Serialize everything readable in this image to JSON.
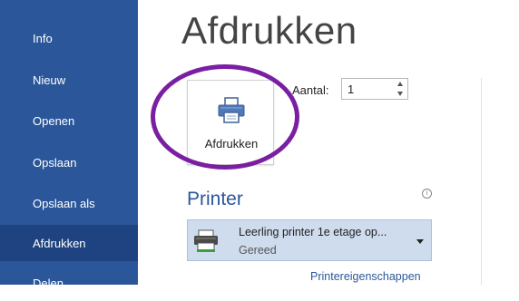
{
  "sidebar": {
    "items": [
      {
        "label": "Info"
      },
      {
        "label": "Nieuw"
      },
      {
        "label": "Openen"
      },
      {
        "label": "Opslaan"
      },
      {
        "label": "Opslaan als"
      },
      {
        "label": "Afdrukken",
        "active": true
      },
      {
        "label": "Delen"
      }
    ]
  },
  "main": {
    "title": "Afdrukken",
    "print_button": {
      "label": "Afdrukken",
      "icon": "printer-icon"
    },
    "copies": {
      "label": "Aantal:",
      "value": "1"
    },
    "printer_section": {
      "title": "Printer",
      "info_icon": "info-icon",
      "selected_printer": {
        "name": "Leerling printer 1e etage op...",
        "status": "Gereed",
        "icon": "printer-device-icon"
      },
      "properties_link": "Printereigenschappen"
    }
  },
  "colors": {
    "sidebar_bg": "#2b579a",
    "sidebar_active": "#1e4380",
    "accent": "#2b579a",
    "highlight_circle": "#7a1fa2",
    "selected_printer_bg": "#cfdcee"
  }
}
